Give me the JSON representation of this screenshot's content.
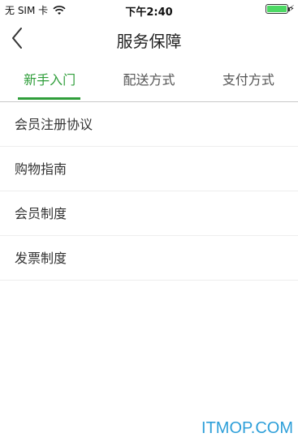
{
  "status_bar": {
    "carrier": "无 SIM 卡",
    "time": "下午2:40",
    "battery_color": "#4cd964"
  },
  "nav": {
    "back_icon": "chevron-left-icon",
    "title": "服务保障"
  },
  "tabs": [
    {
      "label": "新手入门",
      "active": true
    },
    {
      "label": "配送方式",
      "active": false
    },
    {
      "label": "支付方式",
      "active": false
    }
  ],
  "accent_color": "#2f9e3a",
  "list": [
    {
      "label": "会员注册协议"
    },
    {
      "label": "购物指南"
    },
    {
      "label": "会员制度"
    },
    {
      "label": "发票制度"
    }
  ],
  "watermark": "ITMOP.COM"
}
